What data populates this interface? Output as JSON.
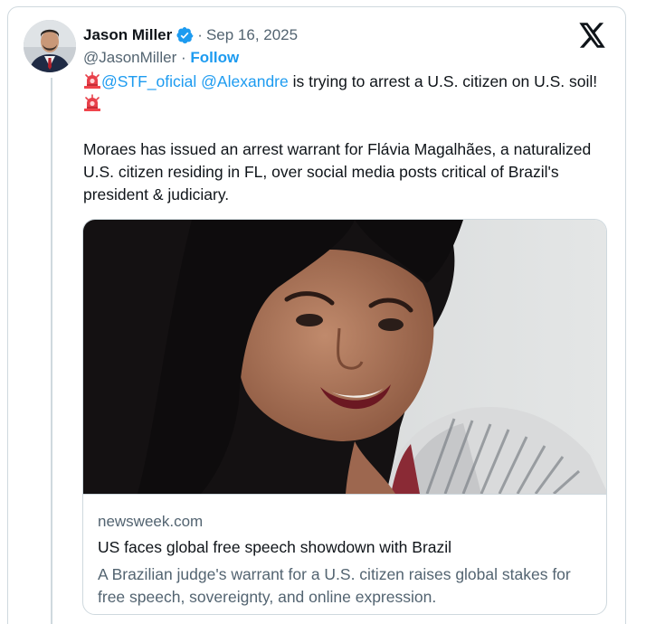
{
  "author": {
    "name": "Jason Miller",
    "handle": "@JasonMiller",
    "date": "Sep 16, 2025",
    "separator": "·",
    "follow_label": "Follow",
    "avatar_icon": "profile-photo"
  },
  "platform_icon": "x-logo-icon",
  "tweet": {
    "mention1": "@STF_oficial",
    "mention2": "@Alexandre",
    "line1_rest": " is trying to arrest a U.S. citizen on U.S. soil!",
    "paragraph2": "Moraes has issued an arrest warrant for Flávia Magalhães, a naturalized U.S. citizen residing in FL, over social media posts critical of Brazil's president & judiciary.",
    "emoji": "siren-icon"
  },
  "link_card": {
    "domain": "newsweek.com",
    "title": "US faces global free speech showdown with Brazil",
    "description": "A Brazilian judge's warrant for a U.S. citizen raises global stakes for free speech, sovereignty, and online expression."
  },
  "colors": {
    "accent": "#1d9bf0",
    "secondary_text": "#536471",
    "border": "#cfd9de"
  }
}
